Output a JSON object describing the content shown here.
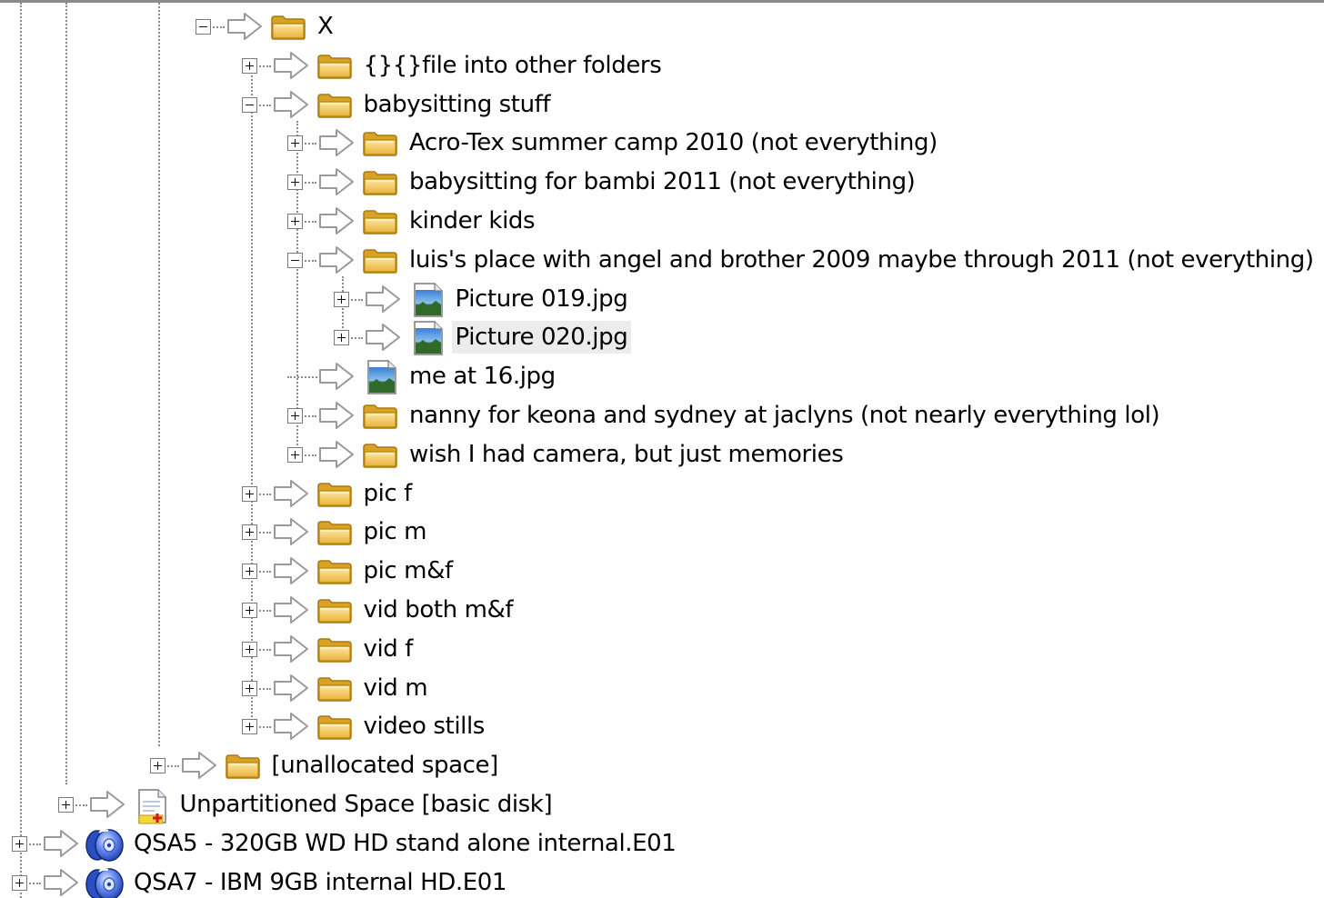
{
  "tree": {
    "nodes": [
      {
        "name": "X",
        "icon": "folder-icon",
        "expander": "minus",
        "depth": 4
      },
      {
        "name": "{}{}file into other folders",
        "icon": "folder-icon",
        "expander": "plus",
        "depth": 5
      },
      {
        "name": "babysitting stuff",
        "icon": "folder-icon",
        "expander": "minus",
        "depth": 5
      },
      {
        "name": "Acro-Tex summer camp 2010 (not everything)",
        "icon": "folder-icon",
        "expander": "plus",
        "depth": 6
      },
      {
        "name": "babysitting for bambi 2011 (not everything)",
        "icon": "folder-icon",
        "expander": "plus",
        "depth": 6
      },
      {
        "name": "kinder kids",
        "icon": "folder-icon",
        "expander": "plus",
        "depth": 6
      },
      {
        "name": "luis's place with angel and brother 2009 maybe through 2011 (not everything)",
        "icon": "folder-icon",
        "expander": "minus",
        "depth": 6
      },
      {
        "name": "Picture 019.jpg",
        "icon": "jpg-image-icon",
        "expander": "plus",
        "depth": 7
      },
      {
        "name": "Picture 020.jpg",
        "icon": "jpg-image-icon",
        "expander": "plus",
        "depth": 7,
        "selected": true
      },
      {
        "name": "me at 16.jpg",
        "icon": "jpg-image-icon",
        "expander": "none",
        "depth": 6
      },
      {
        "name": "nanny for keona and sydney at jaclyns (not nearly everything lol)",
        "icon": "folder-icon",
        "expander": "plus",
        "depth": 6
      },
      {
        "name": "wish I had camera, but just memories",
        "icon": "folder-icon",
        "expander": "plus",
        "depth": 6
      },
      {
        "name": "pic f",
        "icon": "folder-icon",
        "expander": "plus",
        "depth": 5
      },
      {
        "name": "pic m",
        "icon": "folder-icon",
        "expander": "plus",
        "depth": 5
      },
      {
        "name": "pic m&f",
        "icon": "folder-icon",
        "expander": "plus",
        "depth": 5
      },
      {
        "name": "vid both m&f",
        "icon": "folder-icon",
        "expander": "plus",
        "depth": 5
      },
      {
        "name": "vid f",
        "icon": "folder-icon",
        "expander": "plus",
        "depth": 5
      },
      {
        "name": "vid m",
        "icon": "folder-icon",
        "expander": "plus",
        "depth": 5
      },
      {
        "name": "video stills",
        "icon": "folder-icon",
        "expander": "plus",
        "depth": 5
      },
      {
        "name": "[unallocated space]",
        "icon": "folder-icon",
        "expander": "plus",
        "depth": 3
      },
      {
        "name": "Unpartitioned Space [basic disk]",
        "icon": "unpartitioned-document-icon",
        "expander": "plus",
        "depth": 1
      },
      {
        "name": "QSA5 - 320GB WD HD stand alone internal.E01",
        "icon": "evidence-disk-icon",
        "expander": "plus",
        "depth": 0
      },
      {
        "name": "QSA7 - IBM 9GB internal HD.E01",
        "icon": "evidence-disk-icon",
        "expander": "plus",
        "depth": 0
      }
    ]
  },
  "colors": {
    "tree_lines": "#8c8c8c",
    "selected_background": "#ececec",
    "folder": "#f2c75a",
    "disk": "#3d63d4",
    "window_top_border": "#8a8a8a"
  }
}
